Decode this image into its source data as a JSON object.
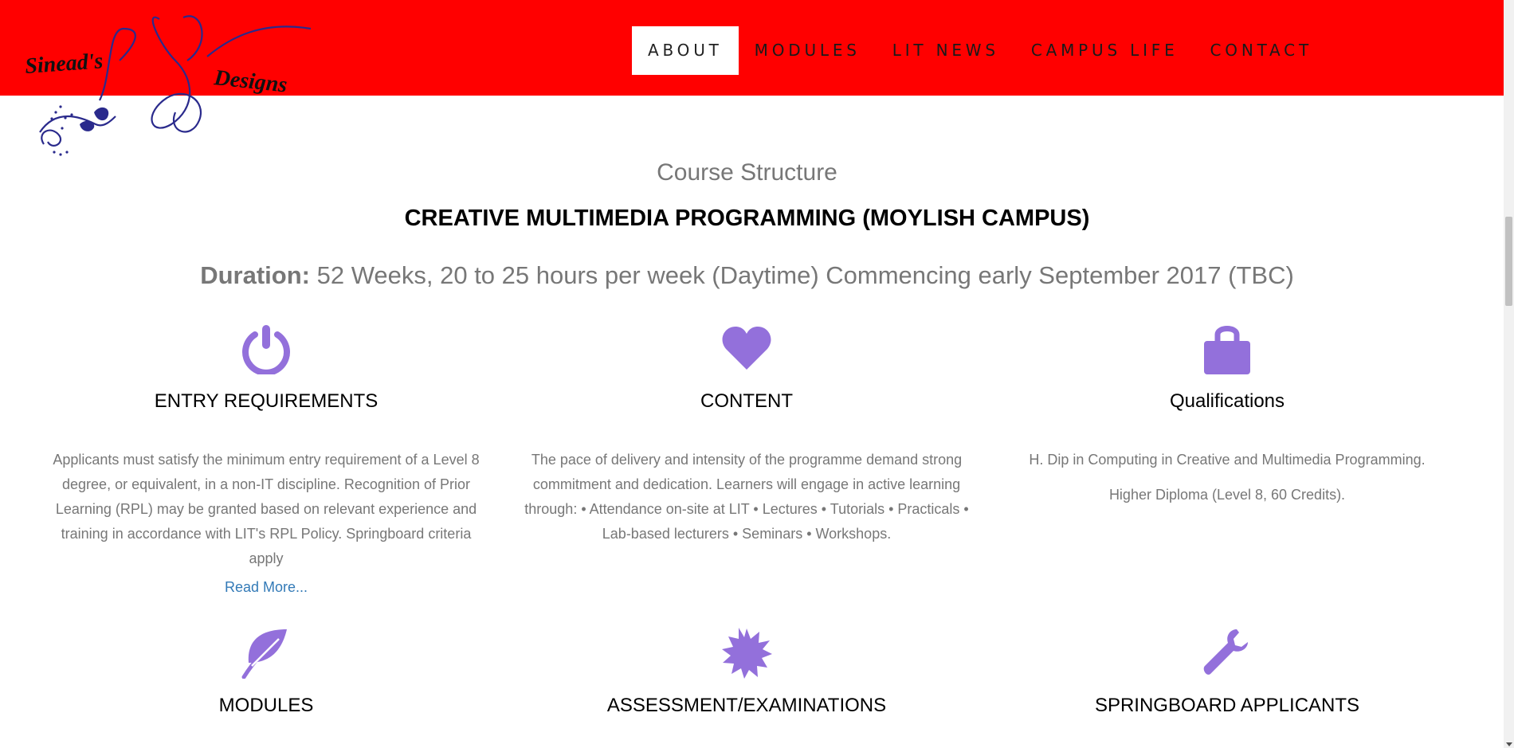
{
  "header": {
    "logo_text_left": "Sinead's",
    "logo_text_right": "Designs",
    "nav": [
      {
        "label": "ABOUT",
        "active": true
      },
      {
        "label": "MODULES",
        "active": false
      },
      {
        "label": "LIT NEWS",
        "active": false
      },
      {
        "label": "CAMPUS LIFE",
        "active": false
      },
      {
        "label": "CONTACT",
        "active": false
      }
    ]
  },
  "main": {
    "subtitle": "Course Structure",
    "title": "CREATIVE MULTIMEDIA PROGRAMMING (MOYLISH CAMPUS)",
    "duration_label": "Duration:",
    "duration_value": " 52 Weeks, 20 to 25 hours per week (Daytime) Commencing early September 2017 (TBC)",
    "features": [
      {
        "icon": "power-icon",
        "title": "ENTRY REQUIREMENTS",
        "text": "Applicants must satisfy the minimum entry requirement of a Level 8 degree, or equivalent, in a non-IT discipline. Recognition of Prior Learning (RPL) may be granted based on relevant experience and training in accordance with LIT's RPL Policy. Springboard criteria apply",
        "link": "Read More..."
      },
      {
        "icon": "heart-icon",
        "title": "CONTENT",
        "text": "The pace of delivery and intensity of the programme demand strong commitment and dedication. Learners will engage in active learning through: • Attendance on-site at LIT • Lectures • Tutorials • Practicals • Lab-based lecturers • Seminars • Workshops."
      },
      {
        "icon": "lock-icon",
        "title": "Qualifications",
        "text": "H. Dip in Computing in Creative and Multimedia Programming.",
        "text2": "Higher Diploma (Level 8, 60 Credits)."
      },
      {
        "icon": "leaf-icon",
        "title": "MODULES"
      },
      {
        "icon": "starburst-icon",
        "title": "ASSESSMENT/EXAMINATIONS"
      },
      {
        "icon": "wrench-icon",
        "title": "SPRINGBOARD APPLICANTS"
      }
    ]
  },
  "colors": {
    "header_bg": "#ff0000",
    "icon": "#9370db",
    "link": "#337ab7",
    "logo": "#2a2a8c"
  }
}
